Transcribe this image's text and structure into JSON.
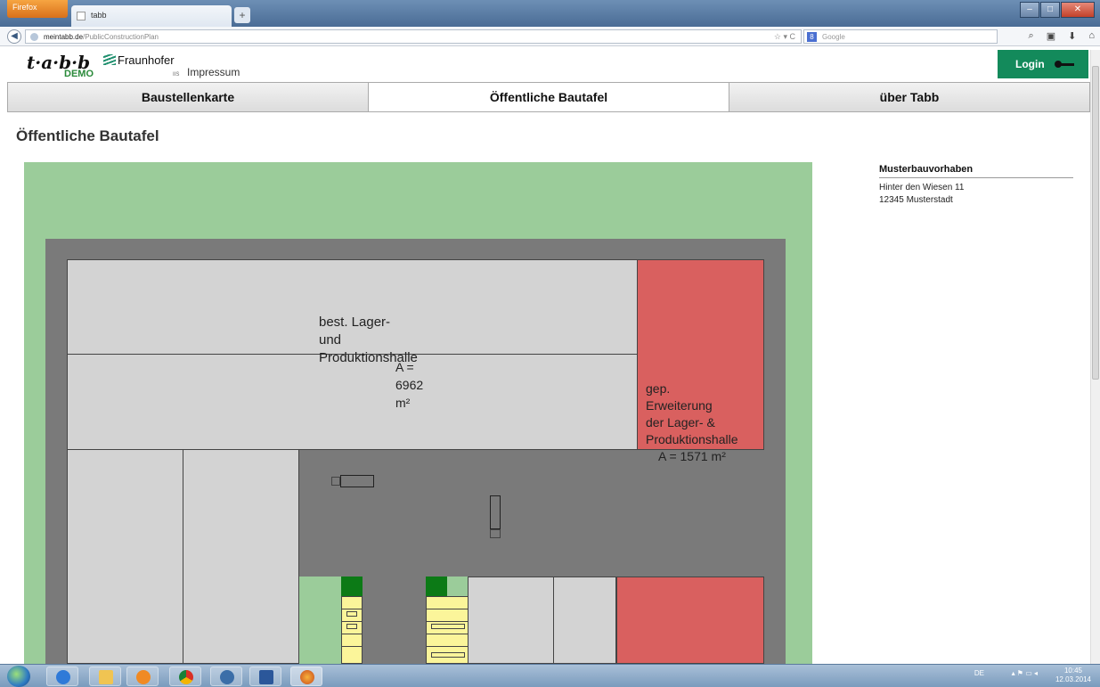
{
  "browser": {
    "app_button": "Firefox",
    "tab_title": "tabb",
    "url_host": "meintabb.de",
    "url_path": "/PublicConstructionPlan",
    "search_placeholder": "Google"
  },
  "header": {
    "logo_text": "t·a·b·b",
    "logo_badge": "DEMO",
    "partner": "Fraunhofer",
    "partner_sub": "IIS",
    "impressum_link": "Impressum",
    "login_label": "Login"
  },
  "menu": {
    "items": [
      {
        "label": "Baustellenkarte"
      },
      {
        "label": "Öffentliche Bautafel"
      },
      {
        "label": "über Tabb"
      }
    ],
    "active_index": 1
  },
  "page": {
    "title": "Öffentliche Bautafel"
  },
  "project": {
    "name": "Musterbauvorhaben",
    "street": "Hinter den Wiesen 11",
    "city": "12345 Musterstadt"
  },
  "plan": {
    "existing_hall": {
      "line1": "best. Lager-",
      "line2": "und Produktionshalle",
      "area": "A = 6962 m²"
    },
    "extension": {
      "line1": "gep. Erweiterung",
      "line2": "der Lager- &",
      "line3": "Produktionshalle",
      "area": "A = 1571 m²"
    },
    "colors": {
      "green": "#9bcc9a",
      "dark_green": "#0c7a16",
      "gray": "#7a7a7a",
      "light_gray": "#d3d3d3",
      "red": "#d9605f",
      "yellow": "#fbf59a"
    }
  },
  "taskbar": {
    "language": "DE",
    "time": "10:45",
    "date": "12.03.2014"
  }
}
